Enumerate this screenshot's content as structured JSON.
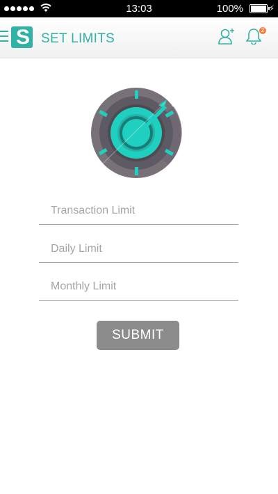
{
  "status_bar": {
    "time": "13:03",
    "battery": "100%"
  },
  "header": {
    "title": "SET LIMITS",
    "logo_letter": "S",
    "notification_count": "2",
    "accent_color": "#31b2a7"
  },
  "icons": {
    "menu": "hamburger-menu-icon",
    "add_user": "add-user-icon",
    "notifications": "bell-icon",
    "hero": "safe-dial-icon"
  },
  "form": {
    "transaction_placeholder": "Transaction Limit",
    "daily_placeholder": "Daily Limit",
    "monthly_placeholder": "Monthly Limit",
    "submit_label": "SUBMIT"
  }
}
